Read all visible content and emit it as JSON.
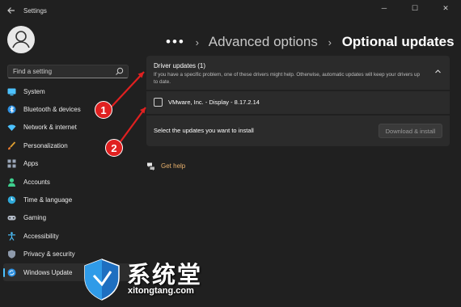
{
  "app": {
    "title": "Settings"
  },
  "window_controls": {
    "minimize": "─",
    "maximize": "☐",
    "close": "✕"
  },
  "search": {
    "placeholder": "Find a setting"
  },
  "sidebar": {
    "items": [
      {
        "label": "System",
        "icon": "monitor-icon"
      },
      {
        "label": "Bluetooth & devices",
        "icon": "bluetooth-icon"
      },
      {
        "label": "Network & internet",
        "icon": "wifi-icon"
      },
      {
        "label": "Personalization",
        "icon": "brush-icon"
      },
      {
        "label": "Apps",
        "icon": "apps-icon"
      },
      {
        "label": "Accounts",
        "icon": "person-icon"
      },
      {
        "label": "Time & language",
        "icon": "globe-clock-icon"
      },
      {
        "label": "Gaming",
        "icon": "gamepad-icon"
      },
      {
        "label": "Accessibility",
        "icon": "accessibility-icon"
      },
      {
        "label": "Privacy & security",
        "icon": "shield-icon"
      },
      {
        "label": "Windows Update",
        "icon": "sync-icon",
        "active": true
      }
    ]
  },
  "breadcrumb": {
    "dots": "•••",
    "sep1": "›",
    "parent": "Advanced options",
    "sep2": "›",
    "current": "Optional updates"
  },
  "driver_updates": {
    "title": "Driver updates (1)",
    "description": "If you have a specific problem, one of these drivers might help. Otherwise, automatic updates will keep your drivers up to date.",
    "items": [
      {
        "label": "VMware, Inc. - Display - 8.17.2.14",
        "checked": false
      }
    ]
  },
  "install": {
    "text": "Select the updates you want to install",
    "button": "Download & install"
  },
  "help": {
    "label": "Get help"
  },
  "annotations": {
    "badge1": "1",
    "badge2": "2"
  },
  "watermark": {
    "title": "系统堂",
    "url": "xitongtang.com"
  },
  "colors": {
    "accent": "#4cc2ff",
    "background": "#202020",
    "card": "#2b2b2b",
    "link": "#e8b16c",
    "annotation": "#e02020"
  }
}
